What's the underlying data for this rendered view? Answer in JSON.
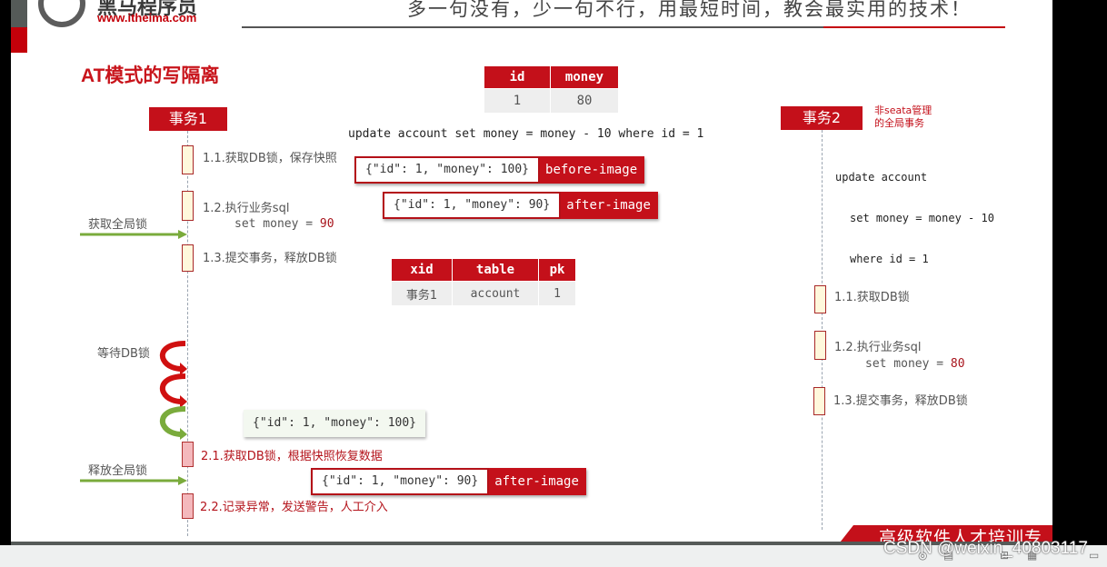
{
  "header": {
    "logo_name": "黑马程序员",
    "logo_url": "www.itheima.com",
    "slogan": "多一句没有，少一句不行，用最短时间，教会最实用的技术！"
  },
  "title": "AT模式的写隔离",
  "account_table": {
    "headers": [
      "id",
      "money"
    ],
    "rows": [
      [
        "1",
        "80"
      ]
    ]
  },
  "update_sql": "update account set money = money - 10 where id = 1",
  "tx1": {
    "label": "事务1",
    "steps": [
      {
        "text": "1.1.获取DB锁，保存快照"
      },
      {
        "text": "1.2.执行业务sql",
        "sub_prefix": "set money = ",
        "sub_value": "90"
      },
      {
        "text": "1.3.提交事务，释放DB锁"
      },
      {
        "text": "2.1.获取DB锁，根据快照恢复数据"
      },
      {
        "text": "2.2.记录异常，发送警告，人工介入"
      }
    ],
    "acquire_global_lock": "获取全局锁",
    "wait_db_lock": "等待DB锁",
    "release_global_lock": "释放全局锁"
  },
  "images": {
    "before_value": "{\"id\": 1, \"money\": 100}",
    "before_label": "before-image",
    "after_value": "{\"id\": 1, \"money\": 90}",
    "after_label": "after-image",
    "restore_value": "{\"id\": 1, \"money\": 100}",
    "after2_value": "{\"id\": 1, \"money\": 90}",
    "after2_label": "after-image"
  },
  "lock_table": {
    "headers": [
      "xid",
      "table",
      "pk"
    ],
    "rows": [
      [
        "事务1",
        "account",
        "1"
      ]
    ]
  },
  "tx2": {
    "label": "事务2",
    "note_line1": "非seata管理",
    "note_line2": "的全局事务",
    "sql_line1": "update account",
    "sql_line2": "set money = money - 10",
    "sql_line3": "where id = 1",
    "steps": [
      {
        "text": "1.1.获取DB锁"
      },
      {
        "text": "1.2.执行业务sql",
        "sub_prefix": "set money = ",
        "sub_value": "80"
      },
      {
        "text": "1.3.提交事务，释放DB锁"
      }
    ]
  },
  "footer": {
    "banner": "高级软件人才培训专家",
    "watermark": "CSDN @weixin_40803117"
  },
  "colors": {
    "brand_red": "#c4101a",
    "green_arrow": "#7aab3c"
  }
}
